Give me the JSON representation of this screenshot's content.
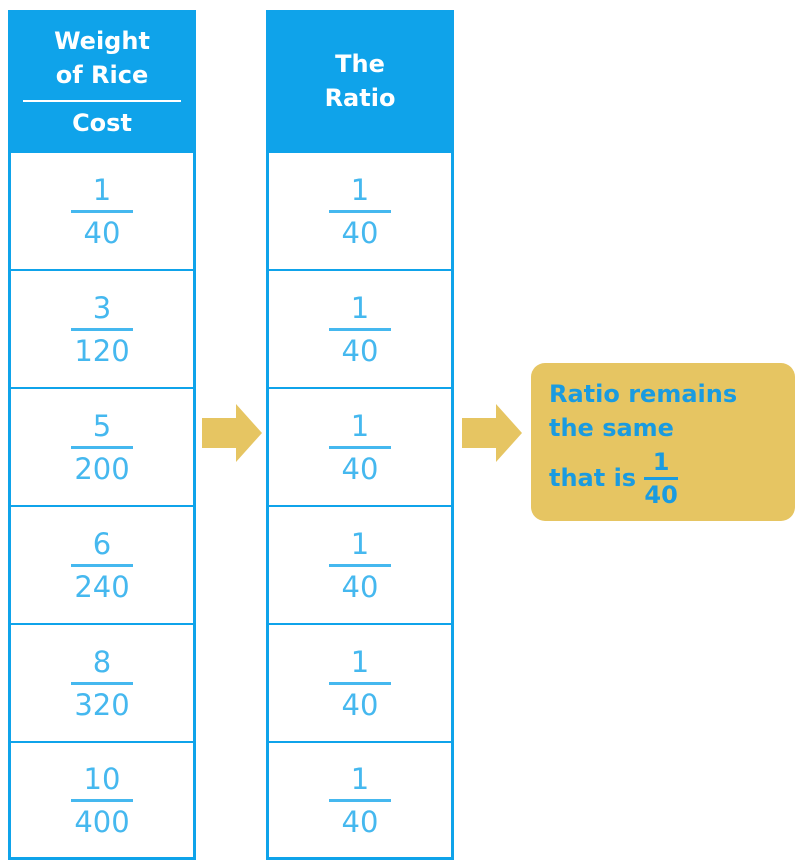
{
  "left_table": {
    "header_top": "Weight\nof Rice",
    "header_top_line1": "Weight",
    "header_top_line2": "of Rice",
    "header_bottom": "Cost",
    "rows": [
      {
        "numerator": "1",
        "denominator": "40"
      },
      {
        "numerator": "3",
        "denominator": "120"
      },
      {
        "numerator": "5",
        "denominator": "200"
      },
      {
        "numerator": "6",
        "denominator": "240"
      },
      {
        "numerator": "8",
        "denominator": "320"
      },
      {
        "numerator": "10",
        "denominator": "400"
      }
    ]
  },
  "right_table": {
    "header_line1": "The",
    "header_line2": "Ratio",
    "rows": [
      {
        "numerator": "1",
        "denominator": "40"
      },
      {
        "numerator": "1",
        "denominator": "40"
      },
      {
        "numerator": "1",
        "denominator": "40"
      },
      {
        "numerator": "1",
        "denominator": "40"
      },
      {
        "numerator": "1",
        "denominator": "40"
      },
      {
        "numerator": "1",
        "denominator": "40"
      }
    ]
  },
  "arrows": [
    "arrow-right-icon",
    "arrow-right-icon"
  ],
  "callout": {
    "line1": "Ratio remains",
    "line2": "the same",
    "line3_prefix": "that is",
    "numerator": "1",
    "denominator": "40"
  },
  "colors": {
    "header_blue": "#0fa3ea",
    "fraction_blue": "#45b8ef",
    "arrow_gold": "#e6c562",
    "callout_text": "#1a9be0"
  }
}
